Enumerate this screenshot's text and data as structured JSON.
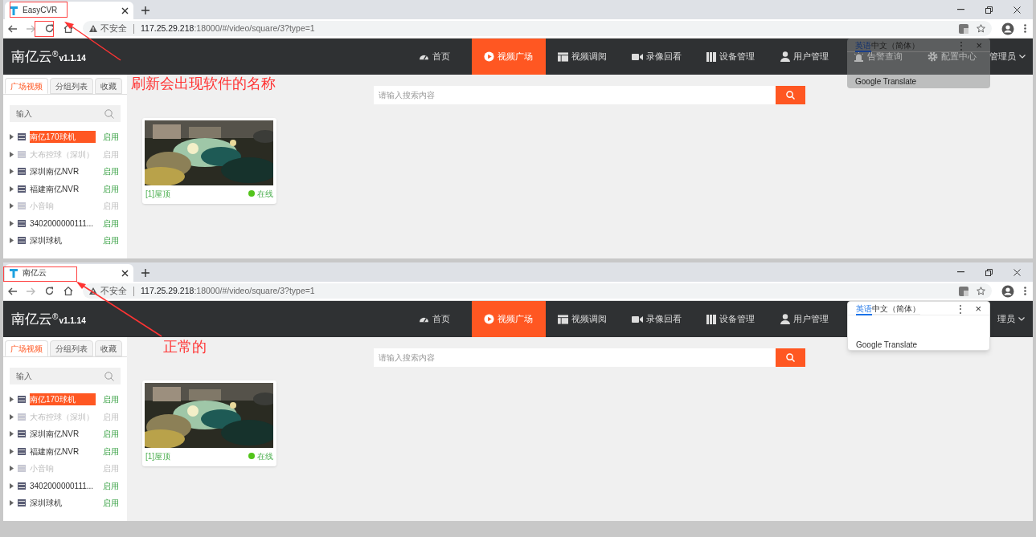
{
  "windows": [
    {
      "tab_title": "EasyCVR",
      "url_warning": "不安全",
      "url_host": "117.25.29.218",
      "url_rest": ":18000/#/video/square/3?type=1",
      "logo": "南亿云",
      "logo_mark": "®",
      "version": "v1.1.14",
      "nav": [
        {
          "label": "首页",
          "selected": false
        },
        {
          "label": "视频广场",
          "selected": true
        },
        {
          "label": "视频调阅",
          "selected": false
        },
        {
          "label": "录像回看",
          "selected": false
        },
        {
          "label": "设备管理",
          "selected": false
        },
        {
          "label": "用户管理",
          "selected": false
        },
        {
          "label": "告警查询",
          "selected": false
        },
        {
          "label": "配置中心",
          "selected": false
        }
      ],
      "user": "管理员",
      "translate_popup": {
        "faded": true,
        "languages": [
          {
            "label": "英语",
            "selected": true
          },
          {
            "label": "中文（简体）",
            "selected": false
          }
        ],
        "more": "⋮",
        "close": "×",
        "brand": "Google Translate"
      },
      "side_tabs": [
        {
          "label": "广场视频",
          "selected": true
        },
        {
          "label": "分组列表",
          "selected": false
        },
        {
          "label": "收藏",
          "selected": false
        }
      ],
      "side_search": {
        "placeholder": "输入"
      },
      "devices": [
        {
          "name": "南亿170球机",
          "status": "启用",
          "enabled": true,
          "selected": true
        },
        {
          "name": "大布控球（深圳）",
          "status": "启用",
          "enabled": false,
          "selected": false
        },
        {
          "name": "深圳南亿NVR",
          "status": "启用",
          "enabled": true,
          "selected": false
        },
        {
          "name": "福建南亿NVR",
          "status": "启用",
          "enabled": true,
          "selected": false
        },
        {
          "name": "小音响",
          "status": "启用",
          "enabled": false,
          "selected": false
        },
        {
          "name": "3402000000111...",
          "status": "启用",
          "enabled": true,
          "selected": false
        },
        {
          "name": "深圳球机",
          "status": "启用",
          "enabled": true,
          "selected": false
        }
      ],
      "main_search": {
        "placeholder": "请输入搜索内容"
      },
      "cameras": [
        {
          "title": "[1]屋顶",
          "status": "在线",
          "online": true
        }
      ],
      "annotation": "刷新会出现软件的名称"
    },
    {
      "tab_title": "南亿云",
      "url_warning": "不安全",
      "url_host": "117.25.29.218",
      "url_rest": ":18000/#/video/square/3?type=1",
      "logo": "南亿云",
      "logo_mark": "®",
      "version": "v1.1.14",
      "nav": [
        {
          "label": "首页",
          "selected": false
        },
        {
          "label": "视频广场",
          "selected": true
        },
        {
          "label": "视频调阅",
          "selected": false
        },
        {
          "label": "录像回看",
          "selected": false
        },
        {
          "label": "设备管理",
          "selected": false
        },
        {
          "label": "用户管理",
          "selected": false
        }
      ],
      "user": "理员",
      "translate_popup": {
        "faded": false,
        "languages": [
          {
            "label": "英语",
            "selected": true
          },
          {
            "label": "中文（简体）",
            "selected": false
          }
        ],
        "more": "⋮",
        "close": "×",
        "brand": "Google Translate"
      },
      "side_tabs": [
        {
          "label": "广场视频",
          "selected": true
        },
        {
          "label": "分组列表",
          "selected": false
        },
        {
          "label": "收藏",
          "selected": false
        }
      ],
      "side_search": {
        "placeholder": "输入"
      },
      "devices": [
        {
          "name": "南亿170球机",
          "status": "启用",
          "enabled": true,
          "selected": true
        },
        {
          "name": "大布控球（深圳）",
          "status": "启用",
          "enabled": false,
          "selected": false
        },
        {
          "name": "深圳南亿NVR",
          "status": "启用",
          "enabled": true,
          "selected": false
        },
        {
          "name": "福建南亿NVR",
          "status": "启用",
          "enabled": true,
          "selected": false
        },
        {
          "name": "小音响",
          "status": "启用",
          "enabled": false,
          "selected": false
        },
        {
          "name": "3402000000111...",
          "status": "启用",
          "enabled": true,
          "selected": false
        },
        {
          "name": "深圳球机",
          "status": "启用",
          "enabled": true,
          "selected": false
        }
      ],
      "main_search": {
        "placeholder": "请输入搜索内容"
      },
      "cameras": [
        {
          "title": "[1]屋顶",
          "status": "在线",
          "online": true
        }
      ],
      "annotation": "正常的"
    }
  ]
}
